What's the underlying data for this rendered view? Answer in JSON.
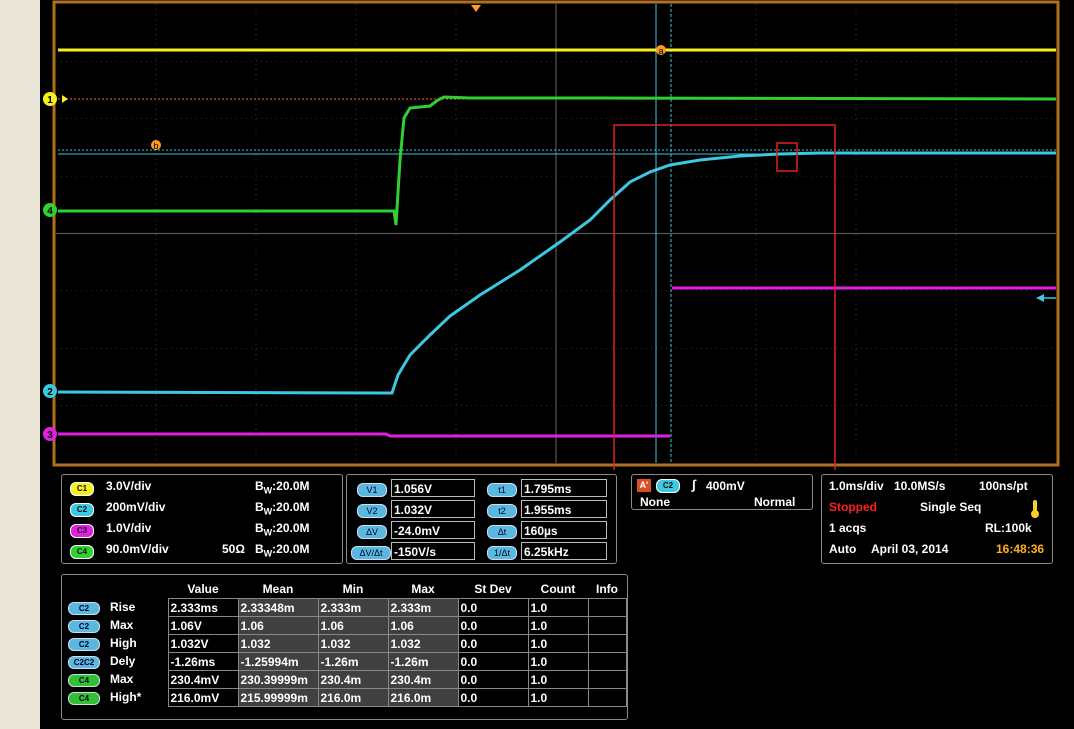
{
  "screen": {
    "trigger_cursor_labels": {
      "a": "a",
      "b": "b"
    },
    "channel_markers": [
      "1",
      "4",
      "2",
      "3"
    ]
  },
  "channels": [
    {
      "badge": "C1",
      "scale": "3.0V/div",
      "impedance": "",
      "bw_prefix": "B",
      "bw_sub": "W",
      "bw": ":20.0M",
      "color": "#f7f020"
    },
    {
      "badge": "C2",
      "scale": "200mV/div",
      "impedance": "",
      "bw_prefix": "B",
      "bw_sub": "W",
      "bw": ":20.0M",
      "color": "#3cc8e0"
    },
    {
      "badge": "C3",
      "scale": "1.0V/div",
      "impedance": "",
      "bw_prefix": "B",
      "bw_sub": "W",
      "bw": ":20.0M",
      "color": "#e020e0"
    },
    {
      "badge": "C4",
      "scale": "90.0mV/div",
      "impedance": "50Ω",
      "bw_prefix": "B",
      "bw_sub": "W",
      "bw": ":20.0M",
      "color": "#30d030"
    }
  ],
  "cursors": {
    "v1_label": "V1",
    "v1": "1.056V",
    "v2_label": "V2",
    "v2": "1.032V",
    "dv_label": "ΔV",
    "dv": "-24.0mV",
    "dvdt_label": "ΔV/Δt",
    "dvdt": "-150V/s",
    "t1_label": "t1",
    "t1": "1.795ms",
    "t2_label": "t2",
    "t2": "1.955ms",
    "dt_label": "Δt",
    "dt": "160µs",
    "inv_label": "1/Δt",
    "inv": "6.25kHz"
  },
  "trigger": {
    "source_badge": "A'",
    "channel_badge": "C2",
    "edge_symbol": "∫",
    "level": "400mV",
    "coupling": "None",
    "mode": "Normal"
  },
  "acquisition": {
    "timebase": "1.0ms/div",
    "sample_rate": "10.0MS/s",
    "resolution": "100ns/pt",
    "state": "Stopped",
    "seq": "Single Seq",
    "acqs": "1 acqs",
    "record_length": "RL:100k",
    "auto": "Auto",
    "date": "April 03, 2014",
    "time": "16:48:36"
  },
  "measurements": {
    "headers": [
      "Value",
      "Mean",
      "Min",
      "Max",
      "St Dev",
      "Count",
      "Info"
    ],
    "rows": [
      {
        "badge": "C2",
        "badge_color": "#5ab8e0",
        "name": "Rise",
        "value": "2.333ms",
        "mean": "2.33348m",
        "min": "2.333m",
        "max": "2.333m",
        "stdev": "0.0",
        "count": "1.0",
        "info": ""
      },
      {
        "badge": "C2",
        "badge_color": "#5ab8e0",
        "name": "Max",
        "value": "1.06V",
        "mean": "1.06",
        "min": "1.06",
        "max": "1.06",
        "stdev": "0.0",
        "count": "1.0",
        "info": ""
      },
      {
        "badge": "C2",
        "badge_color": "#5ab8e0",
        "name": "High",
        "value": "1.032V",
        "mean": "1.032",
        "min": "1.032",
        "max": "1.032",
        "stdev": "0.0",
        "count": "1.0",
        "info": ""
      },
      {
        "badge": "C2C2",
        "badge_color": "#5ab8e0",
        "name": "Dely",
        "value": "-1.26ms",
        "mean": "-1.25994m",
        "min": "-1.26m",
        "max": "-1.26m",
        "stdev": "0.0",
        "count": "1.0",
        "info": ""
      },
      {
        "badge": "C4",
        "badge_color": "#30c030",
        "name": "Max",
        "value": "230.4mV",
        "mean": "230.39999m",
        "min": "230.4m",
        "max": "230.4m",
        "stdev": "0.0",
        "count": "1.0",
        "info": ""
      },
      {
        "badge": "C4",
        "badge_color": "#30c030",
        "name": "High*",
        "value": "216.0mV",
        "mean": "215.99999m",
        "min": "216.0m",
        "max": "216.0m",
        "stdev": "0.0",
        "count": "1.0",
        "info": ""
      }
    ]
  },
  "colors": {
    "ch1": "#f7f020",
    "ch2": "#3cc8e0",
    "ch3": "#e020e0",
    "ch4": "#30d030",
    "frame": "#b07020",
    "annotation": "#e02020",
    "stopped": "#ff2020",
    "time": "#ffb020"
  }
}
